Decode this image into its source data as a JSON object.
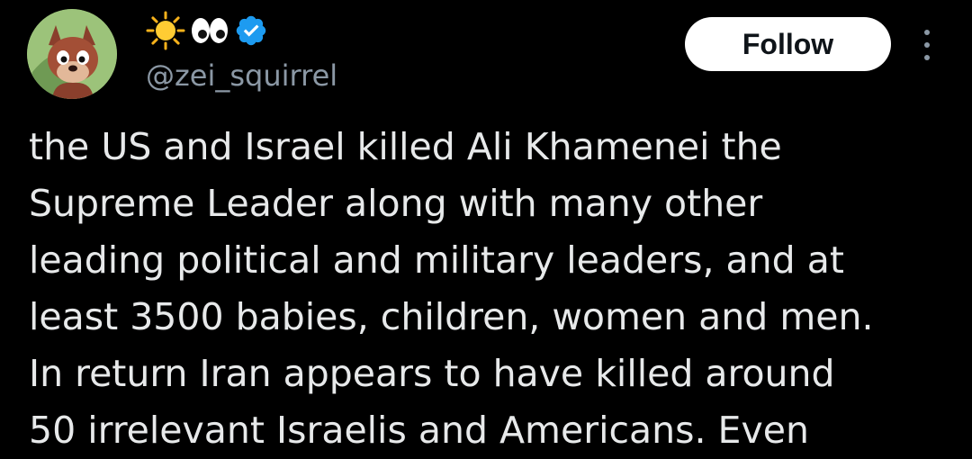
{
  "tweet": {
    "author": {
      "display_name_icons": [
        "sun-icon",
        "eyes-icon"
      ],
      "verified_badge": "verified-badge-icon",
      "handle": "@zei_squirrel",
      "avatar": "squirrel-avatar"
    },
    "follow_label": "Follow",
    "more_icon": "more-options-icon",
    "text_lines": [
      "the US and Israel killed Ali Khamenei the",
      "Supreme Leader along with many other",
      "leading political and military leaders, and at",
      "least 3500 babies, children, women and men.",
      "In return Iran appears to have killed around",
      "50 irrelevant Israelis and Americans. Even"
    ]
  },
  "colors": {
    "background": "#000000",
    "text_primary": "#e7e9ea",
    "text_secondary": "#8b98a5",
    "follow_bg": "#ffffff",
    "follow_text": "#0f1419",
    "verified_blue": "#1d9bf0"
  }
}
